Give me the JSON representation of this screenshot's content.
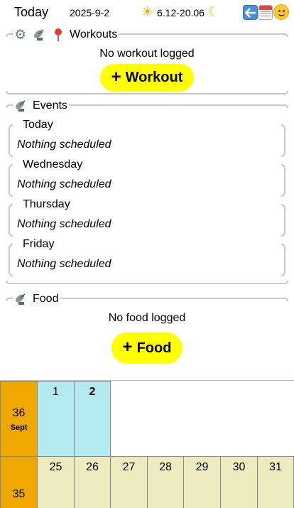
{
  "header": {
    "title": "Today",
    "date": "2025-9-2",
    "sun_icon": "sun-icon",
    "daylight": "6.12-20.06",
    "moon_icon": "crescent-moon-icon",
    "buttons": [
      "back-arrow-icon",
      "calendar-icon",
      "smiley-face-icon"
    ]
  },
  "workouts": {
    "title": "Workouts",
    "icons": [
      "gear-icon",
      "satellite-dish-icon",
      "pin-icon"
    ],
    "empty_text": "No workout logged",
    "add_label": "Workout"
  },
  "events": {
    "title": "Events",
    "icon": "satellite-dish-icon",
    "days": [
      {
        "day": "Today",
        "text": "Nothing scheduled"
      },
      {
        "day": "Wednesday",
        "text": "Nothing scheduled"
      },
      {
        "day": "Thursday",
        "text": "Nothing scheduled"
      },
      {
        "day": "Friday",
        "text": "Nothing scheduled"
      }
    ]
  },
  "food": {
    "title": "Food",
    "icon": "satellite-dish-icon",
    "empty_text": "No food logged",
    "add_label": "Food"
  },
  "calendar": {
    "weeks": [
      {
        "week": "36",
        "month": "Sept",
        "days": [
          "1",
          "2"
        ],
        "current_day": "2"
      },
      {
        "week": "35",
        "month": "",
        "days": [
          "25",
          "26",
          "27",
          "28",
          "29",
          "30",
          "31"
        ]
      }
    ],
    "colors": {
      "week": "#eea800",
      "current_month": "#b4ebf0",
      "previous_month": "#ececc0"
    }
  }
}
